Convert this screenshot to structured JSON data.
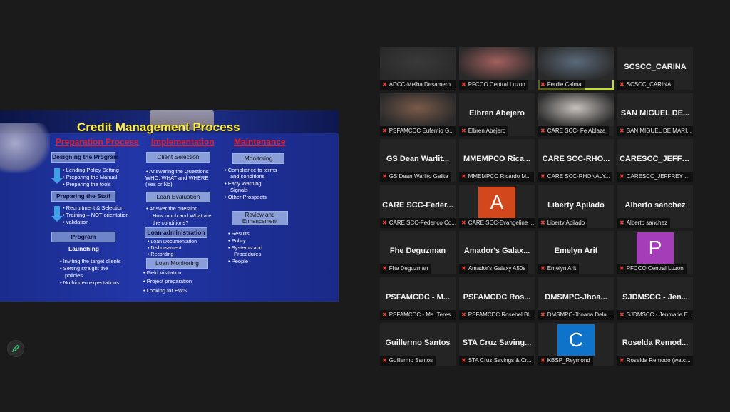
{
  "slide": {
    "title": "Credit Management Process",
    "columns": {
      "prep": "Preparation Process",
      "impl": "Implementation",
      "maint": "Maintenance"
    },
    "prep": {
      "box1": "Designing the Program",
      "b1": "Lending Policy Setting",
      "b2": "Preparing the Manual",
      "b3": "Preparing the tools",
      "box2": "Preparing the Staff",
      "b4": "Recruitment & Selection",
      "b5": "Training – NOT orientation",
      "b6": "validation",
      "box3": "Program",
      "launch": "Launching",
      "b7": "Inviting the target clients",
      "b8a": "Setting straight the",
      "b8b": "policies",
      "b9": "No hidden expectations"
    },
    "impl": {
      "box1": "Client Selection",
      "t1a": "Answering the Questions",
      "t1b": "WHO, WHAT and WHERE",
      "t1c": "(Yes or No)",
      "box2": "Loan Evaluation",
      "t2a": "Answer the question",
      "t2b": "How much and What are",
      "t2c": "the conditions?",
      "box3": "Loan administration",
      "b1": "Loan Documentation",
      "b2": "Disbursement",
      "b3": "Recording",
      "box4": "Loan Monitoring",
      "b4": "Field Visitation",
      "b5": "Project preparation",
      "b6": "Looking for EWS"
    },
    "maint": {
      "box1": "Monitoring",
      "b1a": "Compliance to terms",
      "b1b": "and conditions",
      "b2a": "Early Warning",
      "b2b": "Signals",
      "b3": "Other Prospects",
      "box2a": "Review and",
      "box2b": "Enhancement",
      "b4": "Results",
      "b5": "Policy",
      "b6a": "Systems and",
      "b6b": "Procedures",
      "b7": "People"
    }
  },
  "participants": [
    {
      "display": "",
      "label": "ADCC-Melba Desamero...",
      "video": true,
      "tone": "#3a3a3a"
    },
    {
      "display": "",
      "label": "PFCCO Central Luzon",
      "video": true,
      "tone": "#a3605e"
    },
    {
      "display": "",
      "label": "Ferdie Calma",
      "video": true,
      "tone": "#5a6a7a",
      "active": true
    },
    {
      "display": "SCSCC_CARINA",
      "label": "SCSCC_CARINA"
    },
    {
      "display": "",
      "label": "PSFAMCDC Eufemio G...",
      "video": true,
      "tone": "#7a5a4a"
    },
    {
      "display": "Elbren Abejero",
      "label": "Elbren Abejero"
    },
    {
      "display": "",
      "label": "CARE SCC- Fe Ablaza",
      "video": true,
      "tone": "#c8c2bd"
    },
    {
      "display": "SAN MIGUEL DE...",
      "label": "SAN MIGUEL DE MARI..."
    },
    {
      "display": "GS Dean Warlit...",
      "label": "GS Dean Warlito Galita"
    },
    {
      "display": "MMEMPCO Rica...",
      "label": "MMEMPCO Ricardo M..."
    },
    {
      "display": "CARE SCC-RHO...",
      "label": "CARE SCC-RHONALY..."
    },
    {
      "display": "CARESCC_JEFFR...",
      "label": "CARESCC_JEFFREY SA..."
    },
    {
      "display": "CARE SCC-Feder...",
      "label": "CARE SCC-Federico Co..."
    },
    {
      "display": "",
      "label": "CARE SCC-Evangeline ...",
      "avatar": "A",
      "avatarColor": "#d2481c"
    },
    {
      "display": "Liberty Apilado",
      "label": "Liberty Apilado"
    },
    {
      "display": "Alberto sanchez",
      "label": "Alberto sanchez"
    },
    {
      "display": "Fhe Deguzman",
      "label": "Fhe Deguzman"
    },
    {
      "display": "Amador's Galax...",
      "label": "Amador's Galaxy A50s"
    },
    {
      "display": "Emelyn Arit",
      "label": "Emelyn Arit"
    },
    {
      "display": "",
      "label": "PFCCO Central Luzon",
      "avatar": "P",
      "avatarColor": "#a63db8"
    },
    {
      "display": "PSFAMCDC - M...",
      "label": "PSFAMCDC - Ma. Teres..."
    },
    {
      "display": "PSFAMCDC Ros...",
      "label": "PSFAMCDC Rosebel Bl..."
    },
    {
      "display": "DMSMPC-Jhoa...",
      "label": "DMSMPC-Jhoana Dela..."
    },
    {
      "display": "SJDMSCC - Jen...",
      "label": "SJDMSCC - Jenmarie E..."
    },
    {
      "display": "Guillermo Santos",
      "label": "Guillermo Santos"
    },
    {
      "display": "STA Cruz Saving...",
      "label": "STA Cruz Savings & Cr..."
    },
    {
      "display": "",
      "label": "KBSP_Reymond",
      "avatar": "C",
      "avatarColor": "#0e73c9"
    },
    {
      "display": "Roselda Remod...",
      "label": "Roselda Remodo (watc..."
    }
  ],
  "icons": {
    "pen": "pen-icon",
    "mic": "mic-muted-icon"
  }
}
